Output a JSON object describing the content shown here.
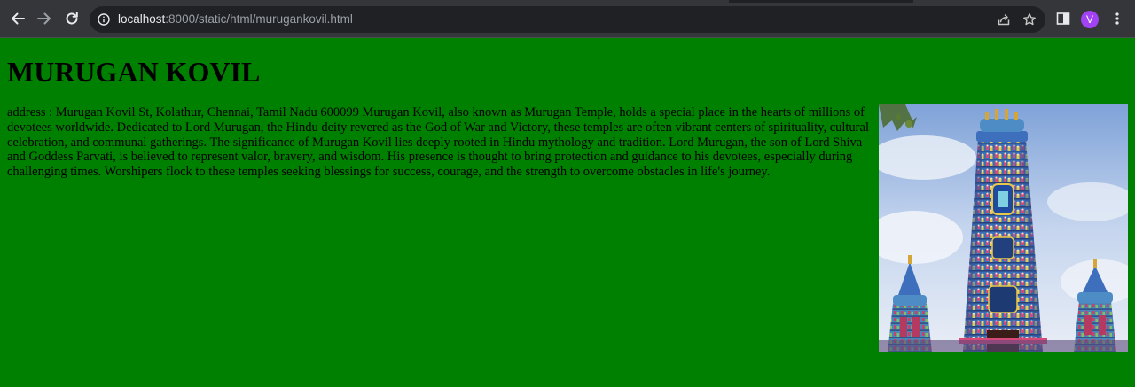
{
  "browser": {
    "url_host": "localhost",
    "url_rest": ":8000/static/html/murugankovil.html",
    "avatar_letter": "V",
    "icons": {
      "back": "arrow-left-icon",
      "forward": "arrow-right-icon",
      "reload": "reload-icon",
      "site_info": "info-icon",
      "share": "share-icon",
      "bookmark": "star-icon",
      "side_panel": "side-panel-icon",
      "menu": "kebab-menu-icon"
    },
    "colors": {
      "chrome": "#35363a",
      "omnibox": "#202124",
      "avatar": "#a142f4"
    }
  },
  "page": {
    "background": "#008000",
    "title": "MURUGAN KOVIL",
    "description": "address : Murugan Kovil St, Kolathur, Chennai, Tamil Nadu 600099 Murugan Kovil, also known as Murugan Temple, holds a special place in the hearts of millions of devotees worldwide. Dedicated to Lord Murugan, the Hindu deity revered as the God of War and Victory, these temples are often vibrant centers of spirituality, cultural celebration, and communal gatherings. The significance of Murugan Kovil lies deeply rooted in Hindu mythology and tradition. Lord Murugan, the son of Lord Shiva and Goddess Parvati, is believed to represent valor, bravery, and wisdom. His presence is thought to bring protection and guidance to his devotees, especially during challenging times. Worshipers flock to these temples seeking blessings for success, courage, and the strength to overcome obstacles in life's journey.",
    "image": "temple-gopuram-photo"
  }
}
